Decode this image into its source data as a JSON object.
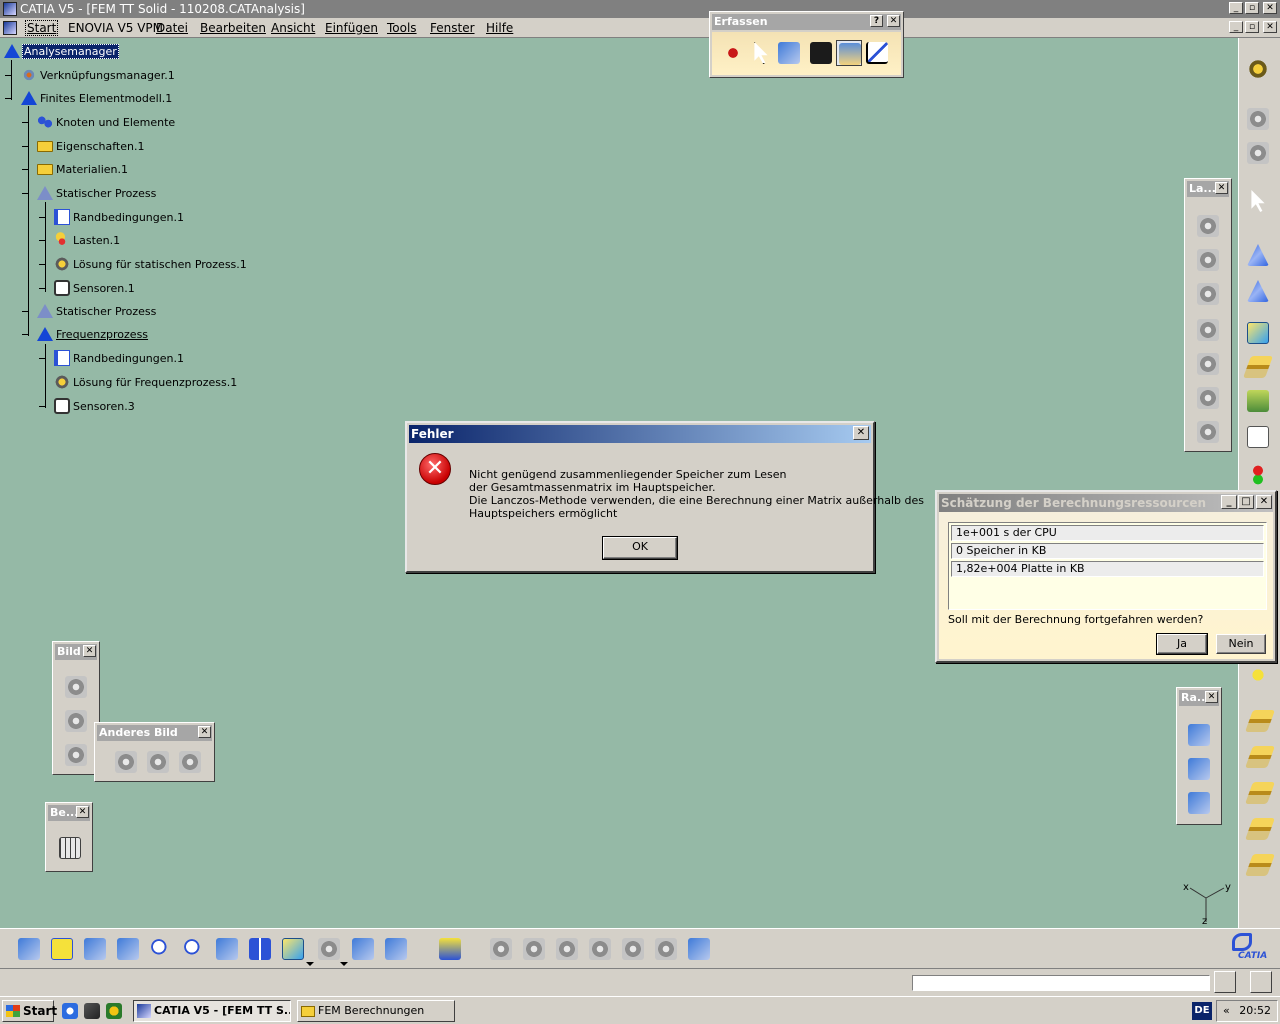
{
  "window": {
    "title": "CATIA V5 - [FEM TT Solid - 110208.CATAnalysis]",
    "controls": [
      "_",
      "▫",
      "✕"
    ]
  },
  "menu": {
    "items": [
      "Start",
      "ENOVIA V5 VPM",
      "Datei",
      "Bearbeiten",
      "Ansicht",
      "Einfügen",
      "Tools",
      "Fenster",
      "Hilfe"
    ]
  },
  "tree": {
    "nodes": [
      {
        "label": "Analysemanager",
        "selected": true
      },
      {
        "label": "Verknüpfungsmanager.1"
      },
      {
        "label": "Finites Elementmodell.1"
      },
      {
        "label": "Knoten und Elemente"
      },
      {
        "label": "Eigenschaften.1"
      },
      {
        "label": "Materialien.1"
      },
      {
        "label": "Statischer Prozess"
      },
      {
        "label": "Randbedingungen.1"
      },
      {
        "label": "Lasten.1"
      },
      {
        "label": "Lösung für statischen Prozess.1"
      },
      {
        "label": "Sensoren.1"
      },
      {
        "label": "Statischer Prozess"
      },
      {
        "label": "Frequenzprozess"
      },
      {
        "label": "Randbedingungen.1"
      },
      {
        "label": "Lösung für Frequenzprozess.1"
      },
      {
        "label": "Sensoren.3"
      }
    ]
  },
  "toolbars": {
    "erfassen": {
      "title": "Erfassen",
      "help": "?",
      "close": "✕"
    },
    "la": {
      "title": "La..."
    },
    "bild": {
      "title": "Bild"
    },
    "anderes_bild": {
      "title": "Anderes Bild"
    },
    "be": {
      "title": "Be..."
    },
    "ra": {
      "title": "Ra..."
    }
  },
  "error_dialog": {
    "title": "Fehler",
    "icon": "error-x-icon",
    "lines": [
      "Nicht genügend zusammenliegender Speicher zum Lesen",
      "der Gesamtmassenmatrix im Hauptspeicher.",
      "Die Lanczos-Methode verwenden, die eine Berechnung einer Matrix außerhalb des",
      "Hauptspeichers ermöglicht"
    ],
    "ok_label": "OK"
  },
  "resource_dialog": {
    "title": "Schätzung der Berechnungsressourcen",
    "rows": [
      "1e+001 s der CPU",
      "0 Speicher in KB",
      "1,82e+004 Platte in KB"
    ],
    "question": "Soll mit der Berechnung fortgefahren werden?",
    "yes_label": "Ja",
    "no_label": "Nein"
  },
  "axis": {
    "x": "x",
    "y": "y",
    "z": "z"
  },
  "logo": {
    "brand": "CATIA"
  },
  "taskbar": {
    "start_label": "Start",
    "tasks": [
      "CATIA V5 - [FEM TT S...",
      "FEM Berechnungen"
    ],
    "lang": "DE",
    "collapse": "«",
    "clock": "20:52"
  },
  "colors": {
    "background": "#95b9a6",
    "chrome": "#d4d0c8",
    "active_caption": "#0a246a",
    "selection": "#0a246a"
  }
}
